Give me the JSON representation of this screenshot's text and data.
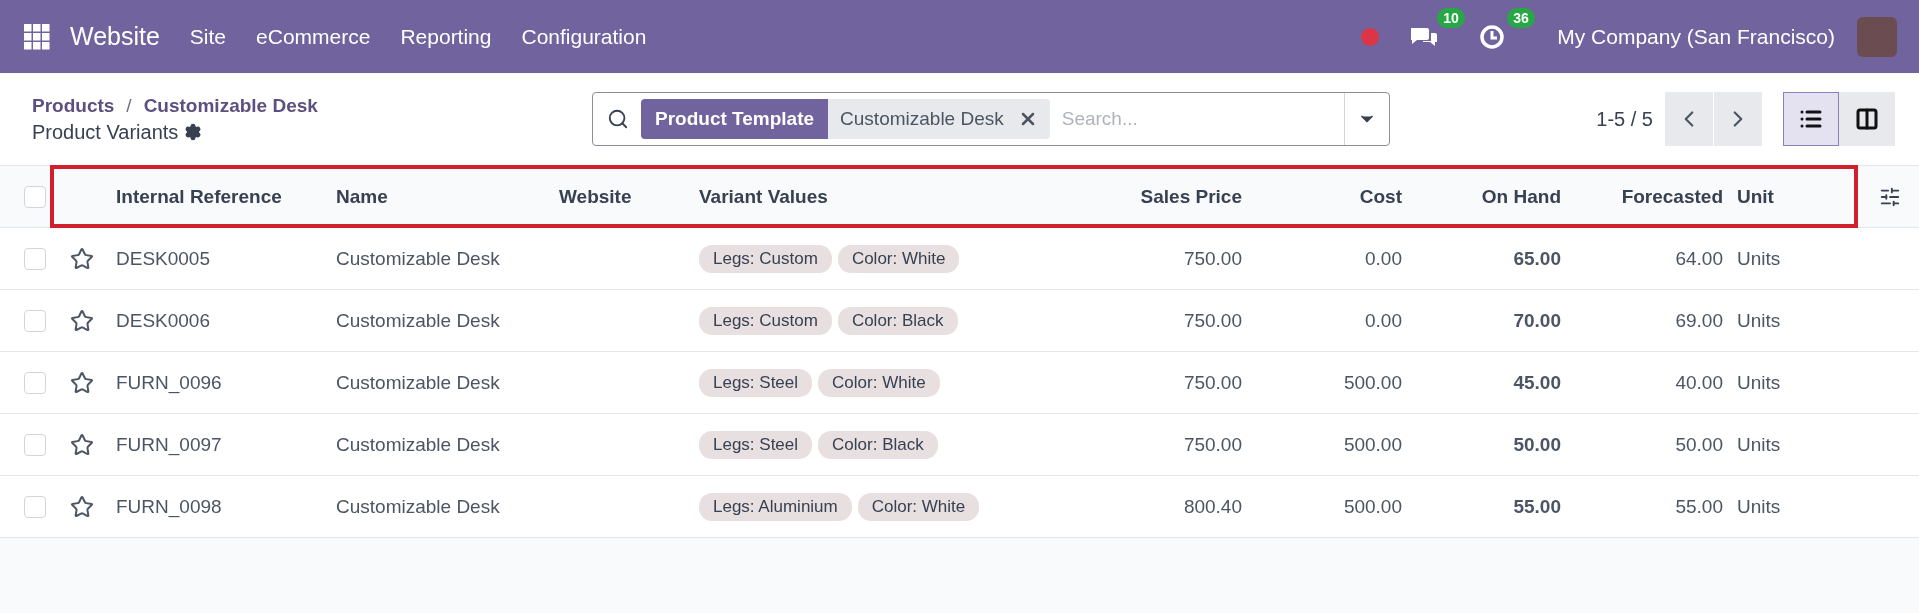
{
  "navbar": {
    "app_name": "Website",
    "menu": [
      "Site",
      "eCommerce",
      "Reporting",
      "Configuration"
    ],
    "messages_count": "10",
    "activities_count": "36",
    "company": "My Company (San Francisco)"
  },
  "control_panel": {
    "breadcrumbs": [
      "Products",
      "Customizable Desk"
    ],
    "breadcrumb_separator": "/",
    "title": "Product Variants",
    "search": {
      "facets": [
        {
          "label": "Product Template",
          "value": "Customizable Desk"
        }
      ],
      "placeholder": "Search..."
    },
    "pager": "1-5 / 5",
    "views": [
      {
        "kind": "list",
        "selected": true
      },
      {
        "kind": "kanban",
        "selected": false
      }
    ]
  },
  "table": {
    "header_highlighted": true,
    "select_all_checked": false,
    "columns": [
      "Internal Reference",
      "Name",
      "Website",
      "Variant Values",
      "Sales Price",
      "Cost",
      "On Hand",
      "Forecasted",
      "Unit"
    ],
    "rows": [
      {
        "selected": false,
        "starred": false,
        "internal_reference": "DESK0005",
        "name": "Customizable Desk",
        "variant_values": [
          "Legs: Custom",
          "Color: White"
        ],
        "sales_price": "750.00",
        "cost": "0.00",
        "on_hand": "65.00",
        "forecasted": "64.00",
        "unit": "Units"
      },
      {
        "selected": false,
        "starred": false,
        "internal_reference": "DESK0006",
        "name": "Customizable Desk",
        "variant_values": [
          "Legs: Custom",
          "Color: Black"
        ],
        "sales_price": "750.00",
        "cost": "0.00",
        "on_hand": "70.00",
        "forecasted": "69.00",
        "unit": "Units"
      },
      {
        "selected": false,
        "starred": false,
        "internal_reference": "FURN_0096",
        "name": "Customizable Desk",
        "variant_values": [
          "Legs: Steel",
          "Color: White"
        ],
        "sales_price": "750.00",
        "cost": "500.00",
        "on_hand": "45.00",
        "forecasted": "40.00",
        "unit": "Units"
      },
      {
        "selected": false,
        "starred": false,
        "internal_reference": "FURN_0097",
        "name": "Customizable Desk",
        "variant_values": [
          "Legs: Steel",
          "Color: Black"
        ],
        "sales_price": "750.00",
        "cost": "500.00",
        "on_hand": "50.00",
        "forecasted": "50.00",
        "unit": "Units"
      },
      {
        "selected": false,
        "starred": false,
        "internal_reference": "FURN_0098",
        "name": "Customizable Desk",
        "variant_values": [
          "Legs: Aluminium",
          "Color: White"
        ],
        "sales_price": "800.40",
        "cost": "500.00",
        "on_hand": "55.00",
        "forecasted": "55.00",
        "unit": "Units"
      }
    ]
  }
}
